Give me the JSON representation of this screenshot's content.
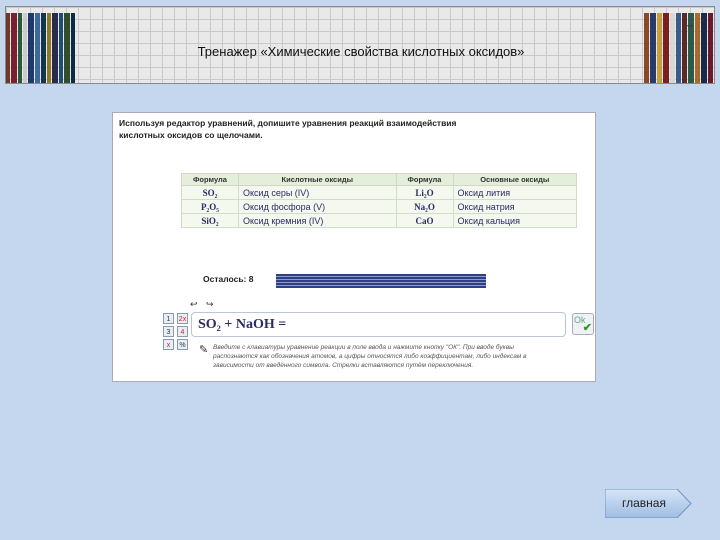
{
  "header": {
    "title": "Тренажер «Химические свойства кислотных оксидов»",
    "window_controls": [
      "_",
      "×"
    ]
  },
  "task": {
    "instruction": "Используя редактор уравнений, допишите уравнения реакций взаимодействия кислотных оксидов со щелочами."
  },
  "oxides_table": {
    "headers": [
      "Формула",
      "Кислотные оксиды",
      "Формула",
      "Основные оксиды"
    ],
    "rows": [
      {
        "acid_formula": "SO₂",
        "acid_name": "Оксид серы (IV)",
        "base_formula": "Li₂O",
        "base_name": "Оксид лития"
      },
      {
        "acid_formula": "P₂O₅",
        "acid_name": "Оксид фосфора (V)",
        "base_formula": "Na₂O",
        "base_name": "Оксид натрия"
      },
      {
        "acid_formula": "SiO₂",
        "acid_name": "Оксид кремния (IV)",
        "base_formula": "CaO",
        "base_name": "Оксид кальция"
      }
    ]
  },
  "progress": {
    "remaining_label": "Осталось: 8"
  },
  "editor": {
    "arrows": "↩ ↪",
    "equation": "SO₂ + NaOH =",
    "ok_label": "Ok",
    "tools": [
      "1",
      "2х",
      "3",
      "4",
      "х",
      "%"
    ],
    "hint": "Введите с клавиатуры уравнение реакции в поле ввода и нажмите кнопку \"ОК\". При вводе буквы распознаются как обозначения атомов, а цифры относятся либо коэффициентам, либо индексам в зависимости от введённого символа. Стрелки вставляются путём переключения."
  },
  "nav": {
    "main_button_label": "главная"
  },
  "colors": {
    "background": "#c5d7ee",
    "table_header": "#e5eeda",
    "remain_bar": "#2e3f84",
    "formula_text": "#2b2b66"
  }
}
